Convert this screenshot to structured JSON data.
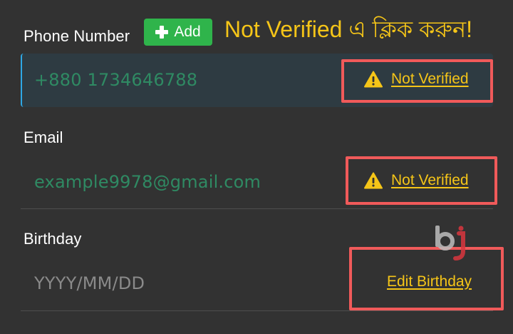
{
  "phone": {
    "label": "Phone Number",
    "add_button": "Add",
    "value": "+880 1734646788",
    "status": "Not Verified"
  },
  "annotation": "Not Verified এ ক্লিক করুন!",
  "email": {
    "label": "Email",
    "value": "example9978@gmail.com",
    "status": "Not Verified"
  },
  "birthday": {
    "label": "Birthday",
    "placeholder": "YYYY/MM/DD",
    "edit_link": "Edit Birthday"
  },
  "colors": {
    "background": "#323232",
    "accent_yellow": "#f5c518",
    "add_green": "#2fb44b",
    "highlight_red": "#f05a5a",
    "phone_field_bg": "#2e3b42"
  },
  "icons": {
    "status": "warning-triangle-icon",
    "add": "plus-icon",
    "watermark": "bj-logo"
  }
}
